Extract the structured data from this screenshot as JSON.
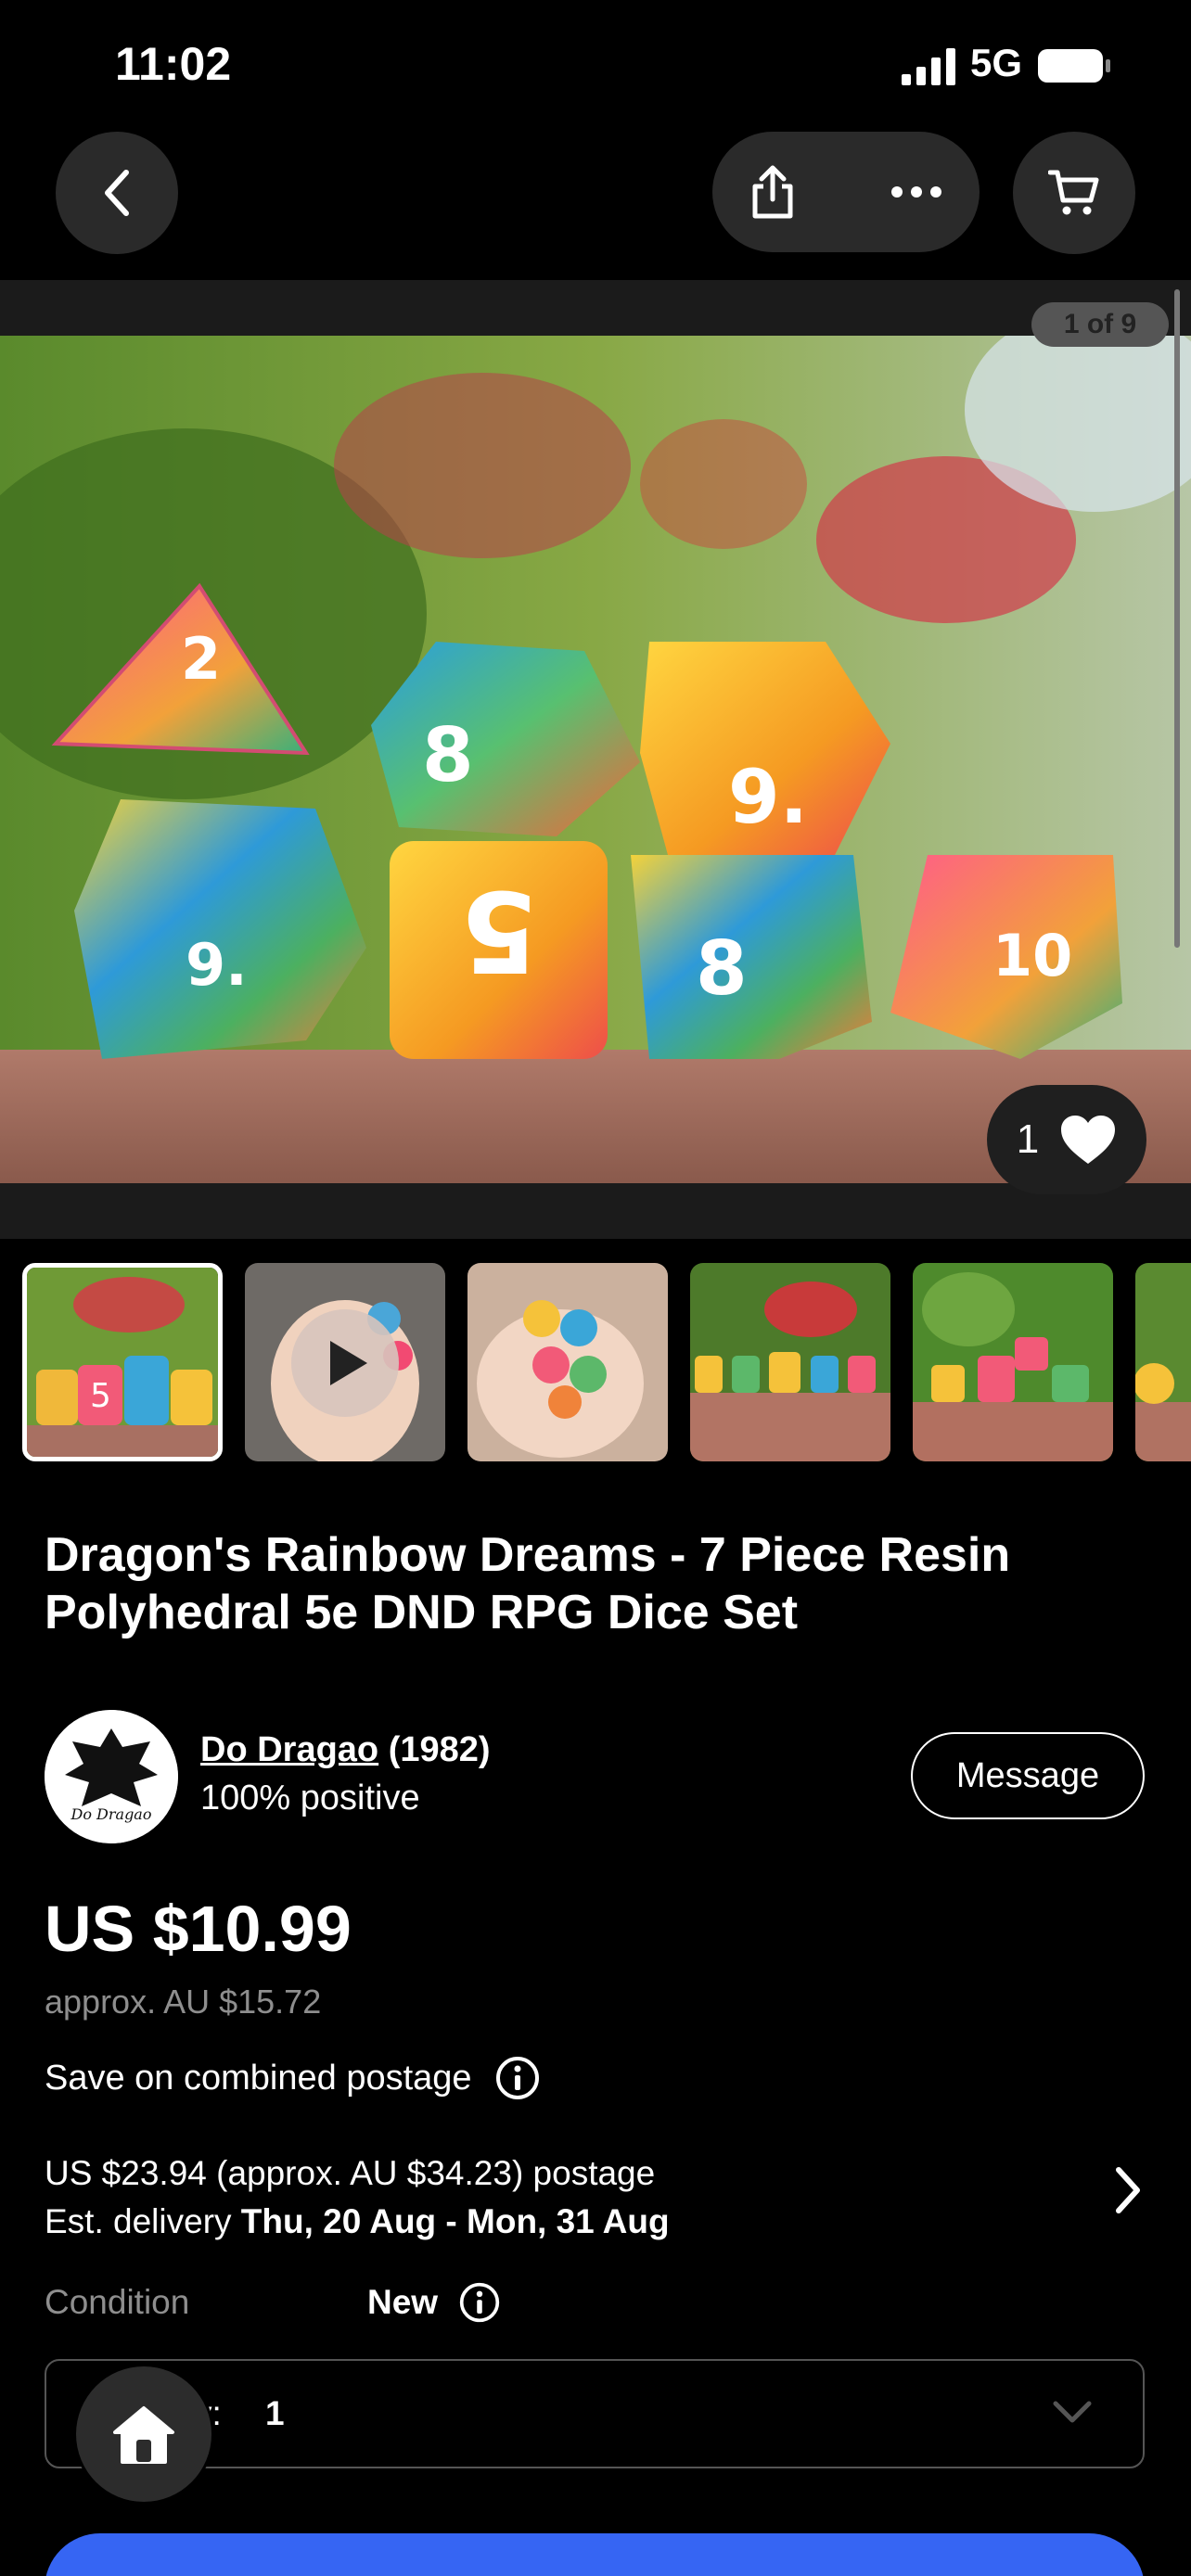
{
  "status_bar": {
    "time": "11:02",
    "network": "5G"
  },
  "gallery": {
    "counter": "1 of 9",
    "like_count": "1"
  },
  "listing": {
    "title": "Dragon's Rainbow Dreams - 7 Piece Resin Polyhedral 5e DND RPG Dice Set"
  },
  "seller": {
    "name": "Do Dragao",
    "score": "(1982)",
    "feedback": "100% positive",
    "avatar_text": "Do Dragao"
  },
  "actions": {
    "message": "Message"
  },
  "pricing": {
    "price": "US $10.99",
    "approx": "approx. AU $15.72",
    "combined_postage": "Save on combined postage"
  },
  "shipping": {
    "postage": "US $23.94 (approx. AU $34.23) postage",
    "delivery_prefix": "Est. delivery",
    "delivery_dates": "Thu, 20 Aug - Mon, 31 Aug"
  },
  "condition": {
    "label": "Condition",
    "value": "New"
  },
  "quantity": {
    "label": "y:",
    "value": "1"
  },
  "colors": {
    "accent": "#3665f3",
    "background": "#000000"
  },
  "icons": [
    "back-icon",
    "share-icon",
    "more-icon",
    "cart-icon",
    "heart-icon",
    "play-icon",
    "info-icon",
    "chevron-right-icon",
    "chevron-down-icon",
    "home-icon"
  ]
}
